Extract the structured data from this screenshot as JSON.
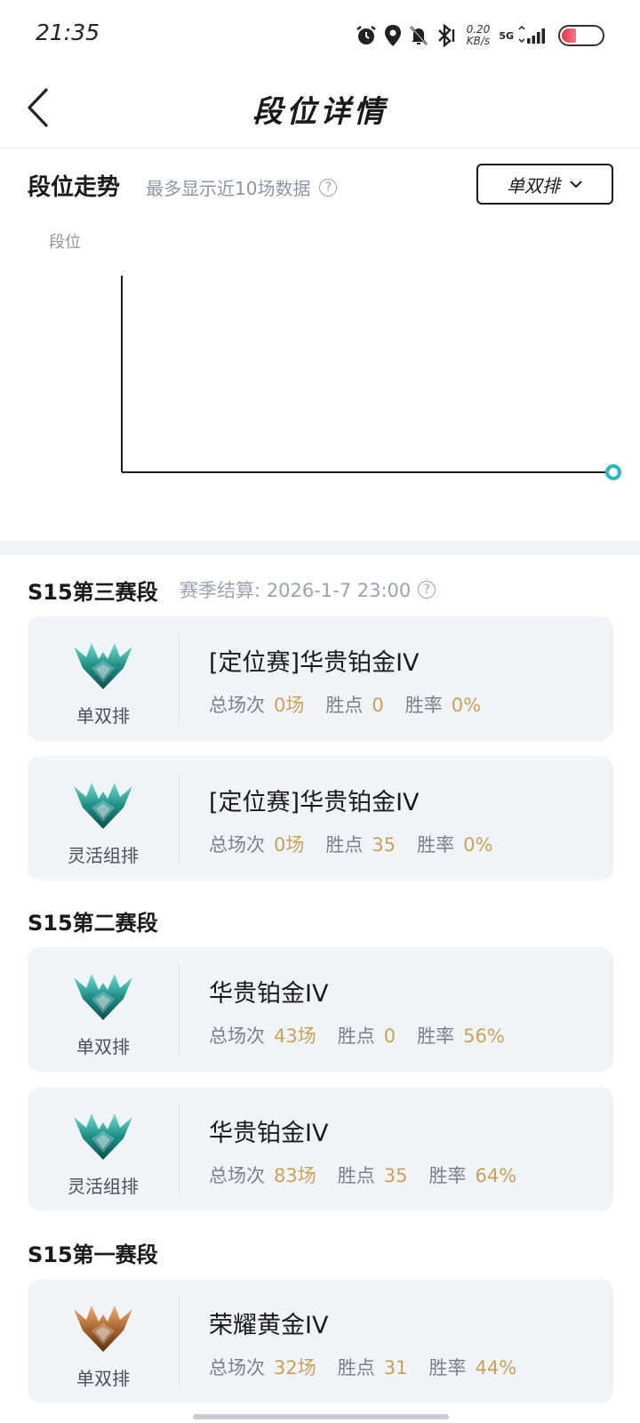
{
  "status": {
    "time": "21:35",
    "net_speed_value": "0.20",
    "net_speed_unit": "KB/s",
    "network": "5G"
  },
  "header": {
    "title": "段位详情"
  },
  "trend": {
    "title": "段位走势",
    "subtitle": "最多显示近10场数据",
    "queue_select": "单双排",
    "y_label": "段位"
  },
  "colors": {
    "accent_value": "#c9a25a",
    "point": "#2ab7bd",
    "card_bg": "#f0f3f8"
  },
  "seasons": [
    {
      "title": "S15第三赛段",
      "settle": "赛季结算: 2026-1-7 23:00",
      "cards": [
        {
          "queue": "单双排",
          "rank": "[定位赛]华贵铂金IV",
          "games_label": "总场次",
          "games": "0场",
          "lp_label": "胜点",
          "lp": "0",
          "wr_label": "胜率",
          "wr": "0%",
          "emblem": "platinum-emblem"
        },
        {
          "queue": "灵活组排",
          "rank": "[定位赛]华贵铂金IV",
          "games_label": "总场次",
          "games": "0场",
          "lp_label": "胜点",
          "lp": "35",
          "wr_label": "胜率",
          "wr": "0%",
          "emblem": "platinum-emblem"
        }
      ]
    },
    {
      "title": "S15第二赛段",
      "cards": [
        {
          "queue": "单双排",
          "rank": "华贵铂金IV",
          "games_label": "总场次",
          "games": "43场",
          "lp_label": "胜点",
          "lp": "0",
          "wr_label": "胜率",
          "wr": "56%",
          "emblem": "platinum-emblem"
        },
        {
          "queue": "灵活组排",
          "rank": "华贵铂金IV",
          "games_label": "总场次",
          "games": "83场",
          "lp_label": "胜点",
          "lp": "35",
          "wr_label": "胜率",
          "wr": "64%",
          "emblem": "platinum-emblem"
        }
      ]
    },
    {
      "title": "S15第一赛段",
      "cards": [
        {
          "queue": "单双排",
          "rank": "荣耀黄金IV",
          "games_label": "总场次",
          "games": "32场",
          "lp_label": "胜点",
          "lp": "31",
          "wr_label": "胜率",
          "wr": "44%",
          "emblem": "gold-emblem"
        }
      ]
    }
  ]
}
